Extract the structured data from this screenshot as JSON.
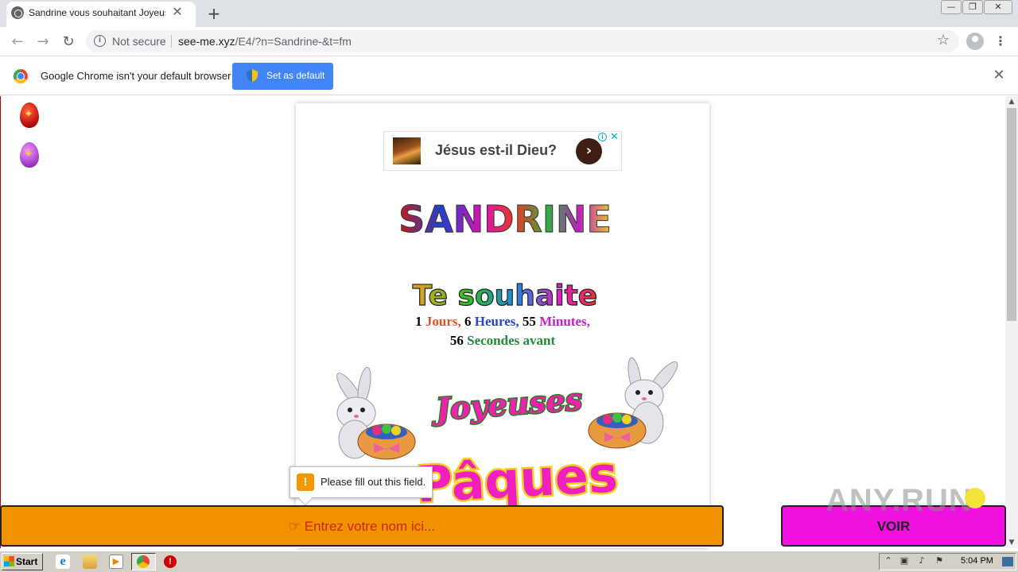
{
  "browser": {
    "tab_title": "Sandrine vous souhaitant Joyeuses P",
    "tab_close": "✕",
    "new_tab": "+",
    "window_controls": [
      "—",
      "❐",
      "✕"
    ],
    "nav": {
      "back": "←",
      "forward": "→",
      "reload": "↻"
    },
    "address": {
      "security_label": "Not secure",
      "host": "see-me.xyz",
      "path": "/E4/?n=Sandrine-&t=fm"
    },
    "star": "☆",
    "menu": "⋮"
  },
  "infobar": {
    "message": "Google Chrome isn't your default browser",
    "button_label": "Set as default",
    "close": "✕"
  },
  "ad": {
    "text": "Jésus est-il Dieu?",
    "go": "›",
    "info": "i",
    "close": "✕"
  },
  "greeting": {
    "name_art": "SANDRINE",
    "wish_art": "Te souhaite",
    "countdown": {
      "days_value": "1",
      "days_label": "Jours,",
      "hours_value": "6",
      "hours_label": "Heures,",
      "minutes_value": "55",
      "minutes_label": "Minutes,",
      "seconds_value": "56",
      "seconds_label": "Secondes avant"
    },
    "joyeuses_art": "Joyeuses",
    "paques_art": "Pâques"
  },
  "validation": {
    "icon": "!",
    "message": "Please fill out this field."
  },
  "form": {
    "name_placeholder": "☞ Entrez votre nom ici...",
    "voir_label": "VOIR"
  },
  "watermark": "ANY.RUN",
  "taskbar": {
    "start_label": "Start",
    "clock": "5:04 PM",
    "ie_glyph": "e",
    "media_glyph": "▶",
    "stop_glyph": "!"
  },
  "colors": {
    "set_default_button": "#4285f4",
    "name_bar": "#f29200",
    "voir_button": "#f010e0",
    "warning": "#f29900"
  }
}
